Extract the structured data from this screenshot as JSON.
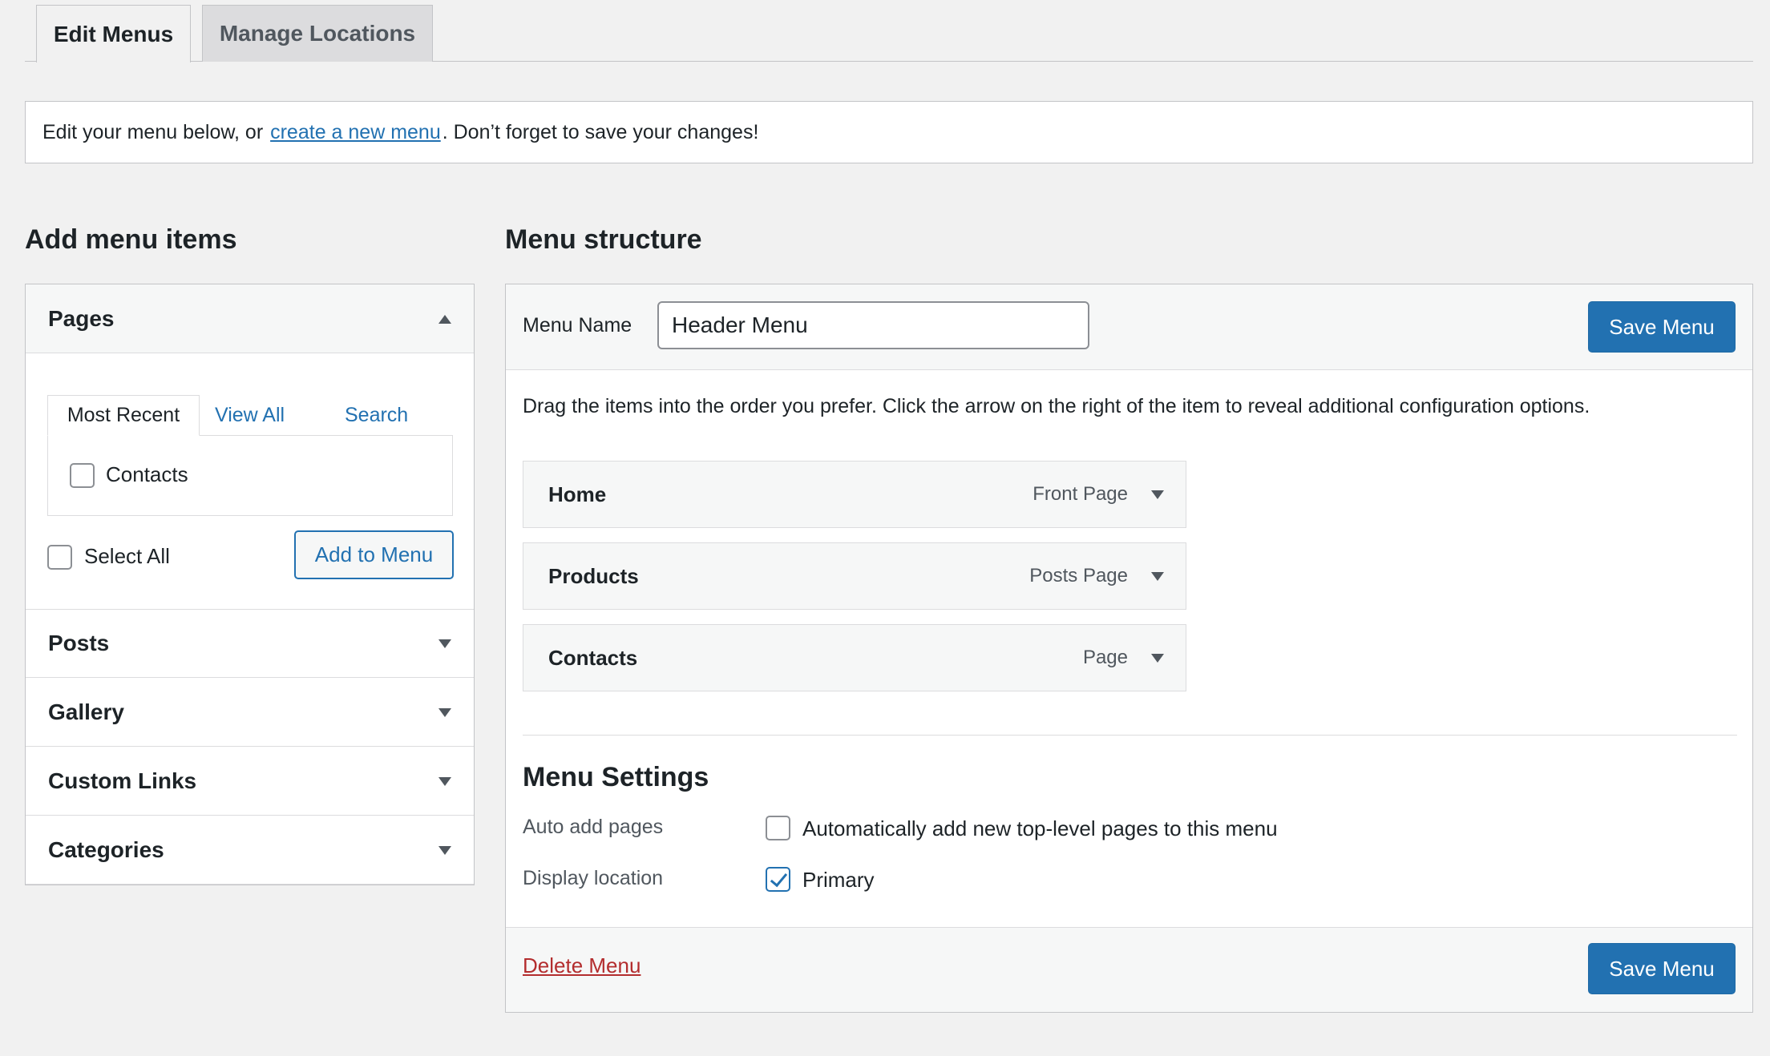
{
  "tabs": [
    {
      "label": "Edit Menus",
      "active": true
    },
    {
      "label": "Manage Locations",
      "active": false
    }
  ],
  "notice": {
    "before": "Edit your menu below, or",
    "link": "create a new menu",
    "after": ". Don’t forget to save your changes!"
  },
  "add_items": {
    "heading": "Add menu items",
    "sections": [
      {
        "label": "Pages",
        "expanded": true
      },
      {
        "label": "Posts",
        "expanded": false
      },
      {
        "label": "Gallery",
        "expanded": false
      },
      {
        "label": "Custom Links",
        "expanded": false
      },
      {
        "label": "Categories",
        "expanded": false
      }
    ],
    "pages": {
      "tabs": [
        "Most Recent",
        "View All",
        "Search"
      ],
      "items": [
        {
          "label": "Contacts",
          "checked": false
        }
      ],
      "select_all": "Select All",
      "add_button": "Add to Menu"
    }
  },
  "structure": {
    "heading": "Menu structure",
    "menu_name_label": "Menu Name",
    "menu_name_value": "Header Menu",
    "save_label": "Save Menu",
    "instructions": "Drag the items into the order you prefer. Click the arrow on the right of the item to reveal additional configuration options.",
    "items": [
      {
        "title": "Home",
        "type": "Front Page"
      },
      {
        "title": "Products",
        "type": "Posts Page"
      },
      {
        "title": "Contacts",
        "type": "Page"
      }
    ],
    "settings": {
      "heading": "Menu Settings",
      "auto_add_label": "Auto add pages",
      "auto_add_text": "Automatically add new top-level pages to this menu",
      "auto_add_checked": false,
      "location_label": "Display location",
      "location_text": "Primary",
      "location_checked": true
    },
    "delete_label": "Delete Menu"
  },
  "colors": {
    "accent": "#2271b1",
    "danger": "#b32d2e",
    "background": "#f1f1f1"
  }
}
